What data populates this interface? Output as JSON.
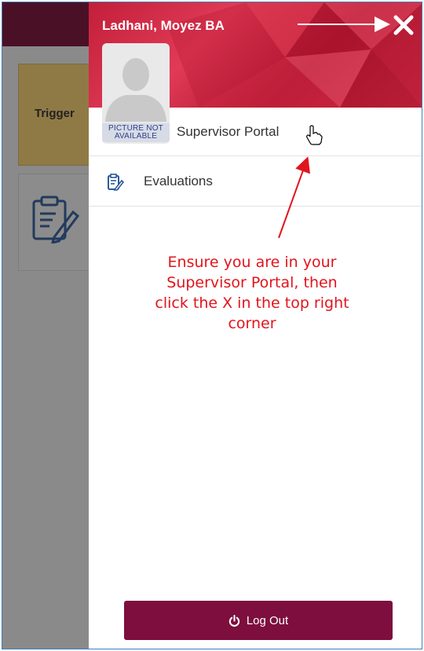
{
  "background": {
    "tile_trigger_label": "Trigger"
  },
  "panel": {
    "user_name": "Ladhani, Moyez BA",
    "avatar_placeholder": "PICTURE NOT AVAILABLE",
    "avatar_line1": "PICTURE NOT",
    "avatar_line2": "AVAILABLE",
    "portal_name": "Supervisor Portal",
    "menu": [
      {
        "label": "Evaluations",
        "icon": "evaluations-clipboard-icon"
      }
    ],
    "logout_label": "Log Out",
    "logout_icon": "power-icon",
    "close_icon": "close-x-icon"
  },
  "annotation": {
    "text_lines": [
      "Ensure you are in your",
      "Supervisor Portal, then",
      "click the X in the top right",
      "corner"
    ],
    "color": "#e2141c"
  },
  "colors": {
    "header_bg": "#4a1126",
    "panel_header_red": "#c21f3a",
    "logout_bg": "#7d0e3e",
    "frame_border": "#3f7fb8"
  }
}
